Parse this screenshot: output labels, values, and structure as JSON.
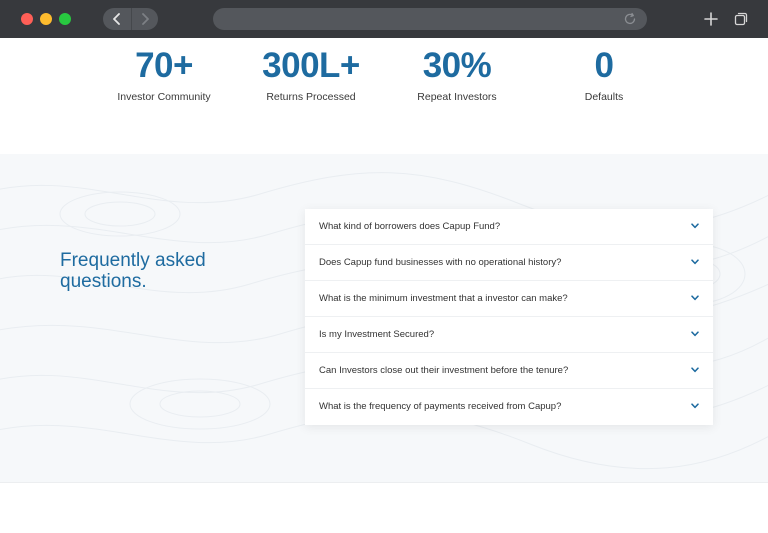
{
  "browser": {
    "traffic_lights": [
      "close",
      "minimize",
      "maximize"
    ],
    "icons": {
      "back": "chevron-left-icon",
      "forward": "chevron-right-icon",
      "reload": "reload-icon",
      "new_tab": "plus-icon",
      "tabs": "tabs-overview-icon"
    }
  },
  "stats": [
    {
      "value": "70+",
      "label": "Investor Community"
    },
    {
      "value": "300L+",
      "label": "Returns Processed"
    },
    {
      "value": "30%",
      "label": "Repeat Investors"
    },
    {
      "value": "0",
      "label": "Defaults"
    }
  ],
  "faq": {
    "title": "Frequently asked questions.",
    "items": [
      "What kind of borrowers does Capup Fund?",
      "Does Capup fund businesses with no operational history?",
      "What is the minimum investment that a investor can make?",
      "Is my Investment Secured?",
      "Can Investors close out their investment before the tenure?",
      "What is the frequency of payments received from Capup?"
    ]
  },
  "colors": {
    "accent": "#1e6ba0",
    "chrome": "#37393d",
    "section_bg": "#f6f8fa"
  }
}
